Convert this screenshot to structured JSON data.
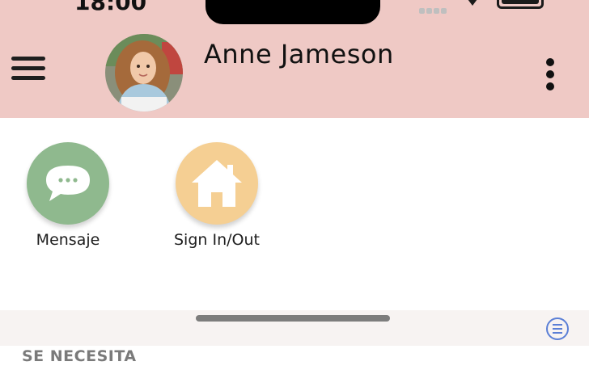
{
  "status_bar": {
    "time": "18:00"
  },
  "header": {
    "user_name": "Anne Jameson",
    "background_color": "#efc9c5"
  },
  "actions": [
    {
      "label": "Mensaje",
      "icon": "chat-bubble-icon",
      "color": "#8fb98e"
    },
    {
      "label": "Sign In/Out",
      "icon": "home-icon",
      "color": "#f5cf93"
    }
  ],
  "section": {
    "title": "SE NECESITA"
  },
  "icons": {
    "menu": "hamburger-menu-icon",
    "more": "more-vertical-icon",
    "list": "list-circle-icon"
  }
}
